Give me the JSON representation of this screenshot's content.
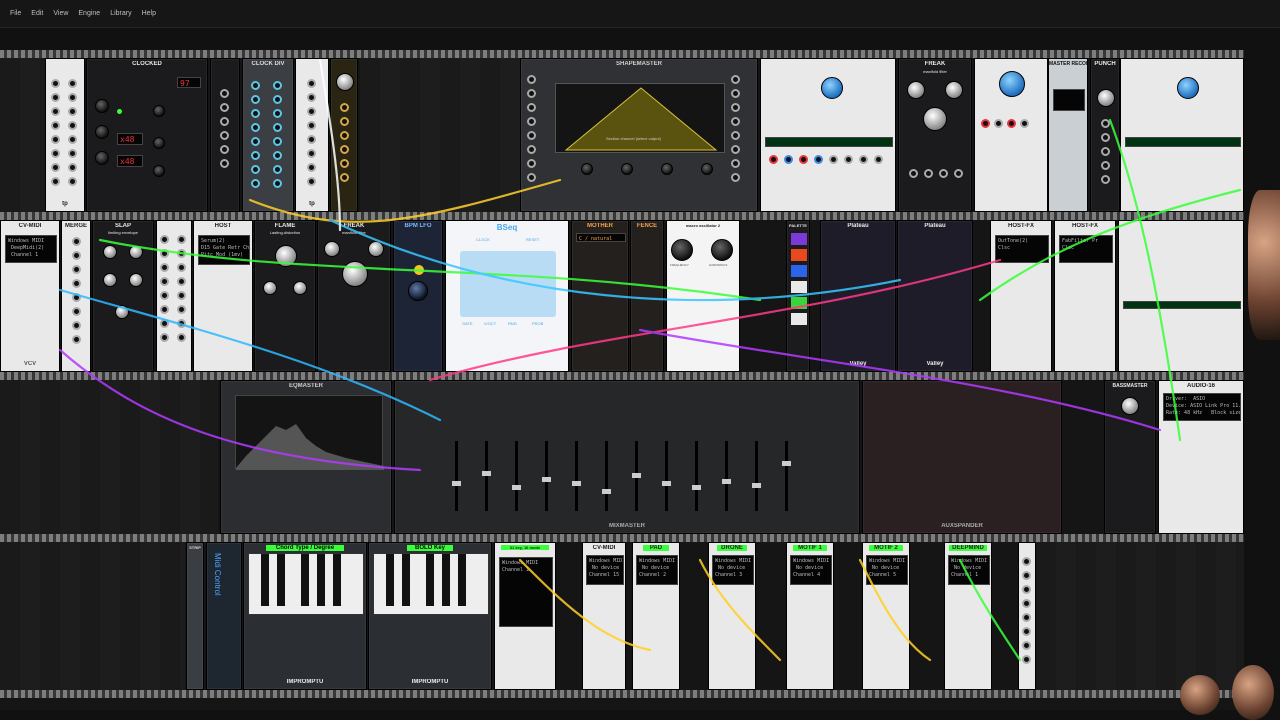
{
  "menu": [
    "File",
    "Edit",
    "View",
    "Engine",
    "Library",
    "Help"
  ],
  "modules": {
    "clocked": {
      "title": "CLOCKED",
      "bpm": "97",
      "ratio_a": "x48",
      "ratio_b": "x48"
    },
    "clkdiv": {
      "title": "CLOCK DIV"
    },
    "shapemaster": {
      "title": "SHAPEMASTER",
      "status": "Section channel (select output)"
    },
    "freak_top": {
      "title": "FREAK",
      "subtitle": "manifold filter"
    },
    "master_recorder": {
      "title": "MASTER RECORDER"
    },
    "punch": {
      "title": "PUNCH",
      "subtitle": "voltage controlled amplifier"
    },
    "cvmidi_left": {
      "title": "CV-MIDI",
      "screen": "Windows MIDI\n DeepMidi(2)\n Channel 1"
    },
    "merge": {
      "title": "MERGE"
    },
    "slap": {
      "title": "SLAP",
      "subtitle": "limiting envelope"
    },
    "host": {
      "title": "HOST",
      "screen": "Serum(2)\nD15 Gate Retr Chan\nPitc Mod (1mv)"
    },
    "flame": {
      "title": "FLAME",
      "subtitle": "Lasting-distortion"
    },
    "freak_mid": {
      "title": "FREAK",
      "subtitle": "manifold filter"
    },
    "bpm_lfo": {
      "title": "BPM LFO"
    },
    "bseq": {
      "title": "BSeq",
      "labels": [
        "CLOCK",
        "RESET",
        "GATE",
        "V/OCT",
        "RND",
        "PROB"
      ]
    },
    "mother": {
      "title": "MOTHER",
      "scale": "C / natural"
    },
    "fence": {
      "title": "FENCE"
    },
    "macro": {
      "title": "macro oscillator 2",
      "labels": [
        "FREQUENCY",
        "HARMONICS",
        "TIMBRE",
        "MORPH"
      ]
    },
    "palette": {
      "title": "PALETTE"
    },
    "plateau": {
      "title": "Plateau",
      "footer": "Valley"
    },
    "plateau2": {
      "title": "Plateau",
      "footer": "Valley"
    },
    "hostfx1": {
      "title": "HOST-FX",
      "screen": "OutTone(2)\nClsc"
    },
    "hostfx2": {
      "title": "HOST-FX",
      "screen": "FabFilter Pr\nClsc"
    },
    "eqmaster": {
      "title": "EQMASTER"
    },
    "mixmaster": {
      "title": "MIXMASTER"
    },
    "auxspander": {
      "title": "AUXSPANDER"
    },
    "bassmaster": {
      "title": "BASSMASTER"
    },
    "audio16": {
      "title": "AUDIO-16",
      "screen": "Driver:  ASIO\nDevice: ASIO Link Pro 11.16 (m\nRate: 48 kHz   Block size"
    },
    "strip": {
      "title": "STRIP"
    },
    "midi_control": {
      "label": "Midi Control"
    },
    "chord_keys": {
      "title": "Chord Type / Degree"
    },
    "bolo_keys": {
      "title": "BOLO Key"
    },
    "impromptu1": {
      "title": "IMPROMPTU"
    },
    "impromptu2": {
      "title": "IMPROMPTU"
    },
    "midi_keys": {
      "title": "31 key,  16 mode",
      "screen": "Windows MIDI\nChannel 1"
    },
    "cvmidi_bottom": {
      "title": "CV-MIDI",
      "screen": "Windows MIDI\n No device\nChannel 15"
    },
    "midi_pad": {
      "title": "PAD",
      "screen": "Windows MIDI\n No device\nChannel 2"
    },
    "midi_drone": {
      "title": "DRONE",
      "screen": "Windows MIDI\n No device\nChannel 3"
    },
    "midi_motif1": {
      "title": "MOTIF 1",
      "screen": "Windows MIDI\n No device\nChannel 4"
    },
    "midi_motif2": {
      "title": "MOTIF 2",
      "screen": "Windows MIDI\n No device\nChannel 5"
    },
    "midi_deepmind": {
      "title": "DEEPMIND",
      "screen": "Windows MIDI\n No device\nChannel 1"
    }
  },
  "tp_label": "tp",
  "vcv_label": "VCV",
  "colors": {
    "rack": "#151515",
    "accent_green": "#39ff3a",
    "accent_red": "#e8333a",
    "screen_green": "#2bff4a"
  }
}
